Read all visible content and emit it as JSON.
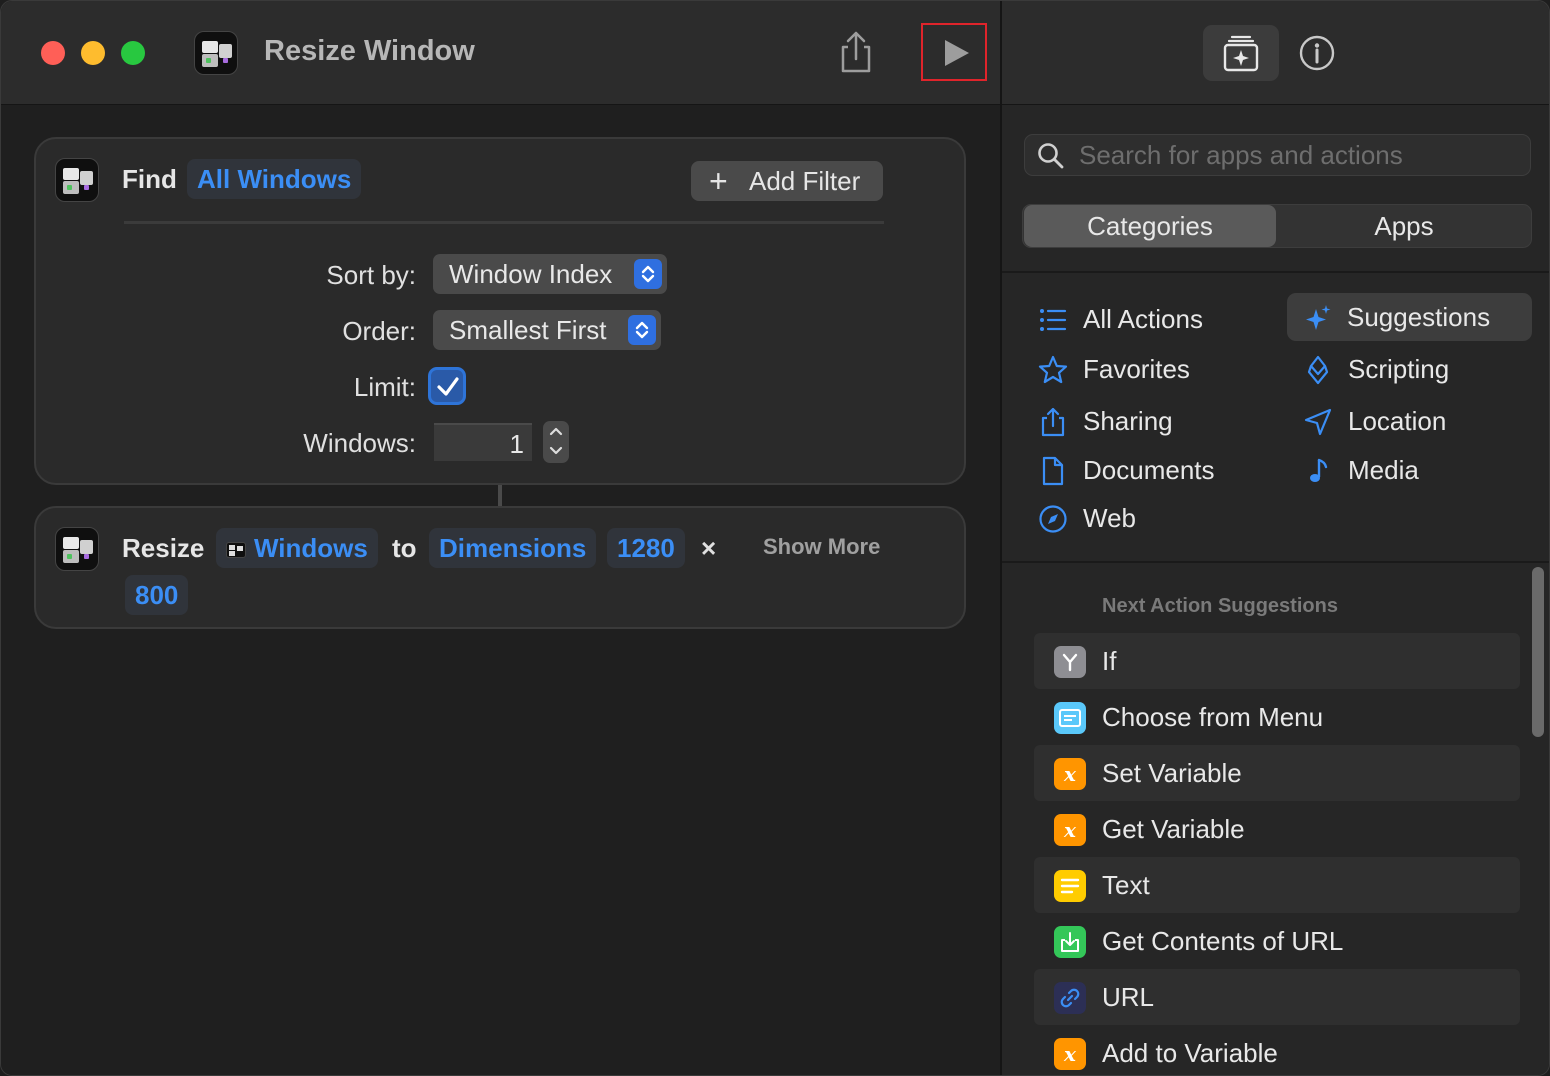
{
  "window": {
    "title": "Resize Window"
  },
  "find_action": {
    "verb": "Find",
    "subject": "All Windows",
    "add_filter_label": "Add Filter",
    "sort_by_label": "Sort by:",
    "sort_by_value": "Window Index",
    "order_label": "Order:",
    "order_value": "Smallest First",
    "limit_label": "Limit:",
    "limit_checked": true,
    "windows_label": "Windows:",
    "windows_value": "1"
  },
  "resize_action": {
    "verb": "Resize",
    "target": "Windows",
    "to_label": "to",
    "mode": "Dimensions",
    "width": "1280",
    "times": "×",
    "height": "800",
    "show_more": "Show More"
  },
  "sidebar": {
    "search_placeholder": "Search for apps and actions",
    "segments": [
      "Categories",
      "Apps"
    ],
    "categories_left": [
      {
        "label": "All Actions",
        "icon": "list-icon"
      },
      {
        "label": "Favorites",
        "icon": "star-icon"
      },
      {
        "label": "Sharing",
        "icon": "share-icon"
      },
      {
        "label": "Documents",
        "icon": "document-icon"
      },
      {
        "label": "Web",
        "icon": "compass-icon"
      }
    ],
    "categories_right": [
      {
        "label": "Suggestions",
        "icon": "sparkle-icon"
      },
      {
        "label": "Scripting",
        "icon": "scripting-icon"
      },
      {
        "label": "Location",
        "icon": "location-arrow-icon"
      },
      {
        "label": "Media",
        "icon": "music-note-icon"
      }
    ],
    "suggestions_header": "Next Action Suggestions",
    "suggestions": [
      {
        "label": "If",
        "icon": "if-icon",
        "color": "#8e8e93"
      },
      {
        "label": "Choose from Menu",
        "icon": "menu-icon",
        "color": "#5ac8fa"
      },
      {
        "label": "Set Variable",
        "icon": "variable-icon",
        "color": "#ff9500"
      },
      {
        "label": "Get Variable",
        "icon": "variable-icon",
        "color": "#ff9500"
      },
      {
        "label": "Text",
        "icon": "text-icon",
        "color": "#ffcc00"
      },
      {
        "label": "Get Contents of URL",
        "icon": "download-icon",
        "color": "#34c759"
      },
      {
        "label": "URL",
        "icon": "link-icon",
        "color": "#2c2f55"
      },
      {
        "label": "Add to Variable",
        "icon": "variable-icon",
        "color": "#ff9500"
      }
    ]
  },
  "colors": {
    "accent": "#3b8ef5",
    "run_highlight": "#e0242b"
  }
}
